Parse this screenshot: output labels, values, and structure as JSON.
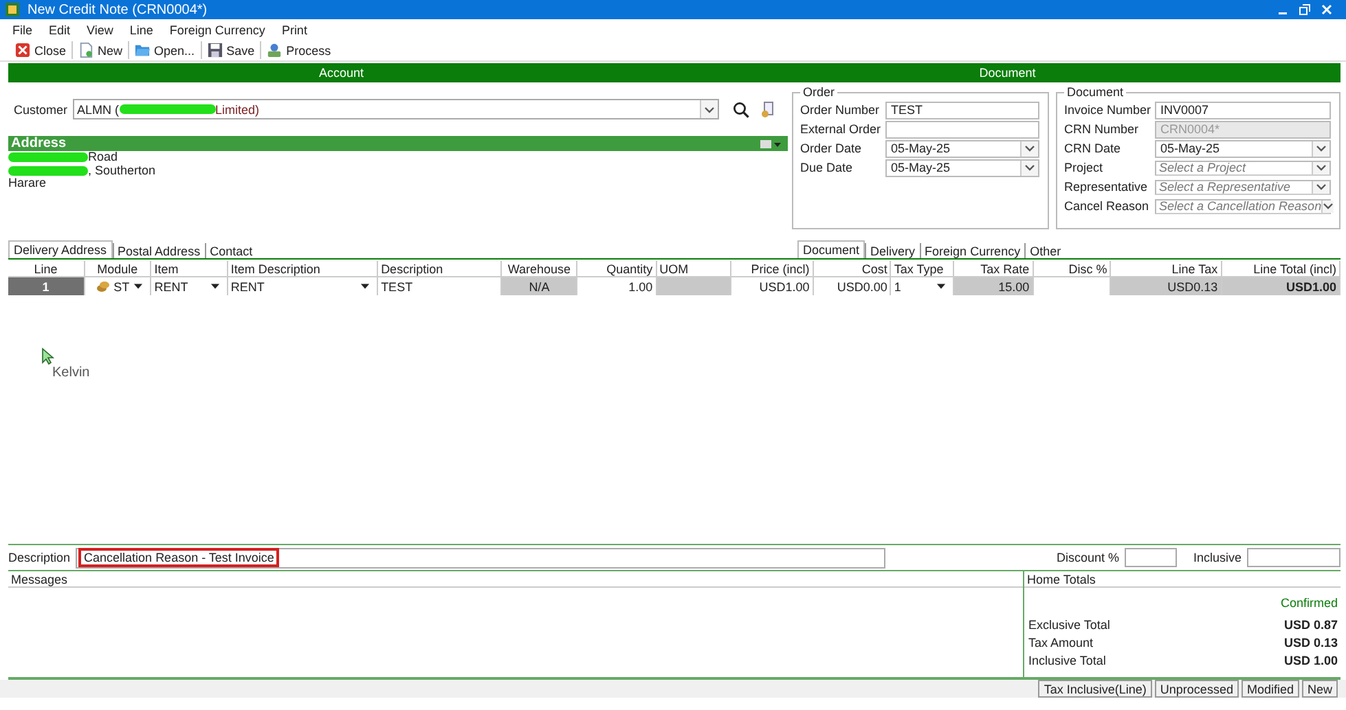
{
  "window": {
    "title": "New Credit Note (CRN0004*)"
  },
  "menu": [
    "File",
    "Edit",
    "View",
    "Line",
    "Foreign Currency",
    "Print"
  ],
  "toolbar": [
    {
      "kind": "close",
      "label": "Close"
    },
    {
      "kind": "new",
      "label": "New"
    },
    {
      "kind": "open",
      "label": "Open..."
    },
    {
      "kind": "save",
      "label": "Save"
    },
    {
      "kind": "process",
      "label": "Process"
    }
  ],
  "section_bar": [
    "Account",
    "Document"
  ],
  "customer": {
    "label": "Customer",
    "value_start": "ALMN (",
    "value_end": "Limited)"
  },
  "address": {
    "title": "Address",
    "lines": [
      {
        "redacted": true,
        "text": "Road"
      },
      {
        "redacted": true,
        "text": ", Southerton"
      },
      {
        "redacted": false,
        "text": "Harare"
      }
    ]
  },
  "left_tabs": [
    {
      "label": "Delivery Address",
      "selected": true
    },
    {
      "label": "Postal Address",
      "selected": false
    },
    {
      "label": "Contact",
      "selected": false
    }
  ],
  "order": {
    "title": "Order",
    "fields": [
      {
        "label": "Order Number",
        "kind": "text",
        "value": "TEST"
      },
      {
        "label": "External Order",
        "kind": "text"
      },
      {
        "label": "Order Date",
        "kind": "dropdown",
        "value": "05-May-25"
      },
      {
        "label": "Due Date",
        "kind": "dropdown",
        "value": "05-May-25"
      }
    ]
  },
  "document": {
    "title": "Document",
    "fields": [
      {
        "label": "Invoice Number",
        "kind": "text",
        "value": "INV0007"
      },
      {
        "label": "CRN Number",
        "kind": "text",
        "value": "CRN0004*",
        "disabled": true
      },
      {
        "label": "CRN Date",
        "kind": "dropdown",
        "value": "05-May-25"
      },
      {
        "label": "Project",
        "kind": "dropdown",
        "placeholder": "Select a Project"
      },
      {
        "label": "Representative",
        "kind": "dropdown",
        "placeholder": "Select a Representative"
      },
      {
        "label": "Cancel Reason",
        "kind": "dropdown",
        "placeholder": "Select a Cancellation Reason"
      }
    ]
  },
  "right_tabs": [
    {
      "label": "Document",
      "selected": true
    },
    {
      "label": "Delivery",
      "selected": false
    },
    {
      "label": "Foreign Currency",
      "selected": false
    },
    {
      "label": "Other",
      "selected": false
    }
  ],
  "table": {
    "columns": [
      "Line",
      "Module",
      "Item",
      "Item Description",
      "Description",
      "Warehouse",
      "Quantity",
      "UOM",
      "Price (incl)",
      "Cost",
      "Tax Type",
      "Tax Rate",
      "Disc %",
      "Line Tax",
      "Line Total (incl)"
    ],
    "rows": [
      {
        "cells": [
          {
            "kind": "line",
            "text": "1"
          },
          {
            "kind": "module",
            "text": "ST"
          },
          {
            "kind": "dropdown",
            "text": "RENT"
          },
          {
            "kind": "dropdown",
            "text": "RENT"
          },
          {
            "kind": "text",
            "text": "TEST"
          },
          {
            "kind": "readonly",
            "text": "N/A"
          },
          {
            "kind": "text",
            "text": "1.00"
          },
          {
            "kind": "readonly"
          },
          {
            "kind": "text",
            "text": "USD1.00"
          },
          {
            "kind": "text",
            "text": "USD0.00"
          },
          {
            "kind": "dropdown",
            "text": "1"
          },
          {
            "kind": "readonly",
            "text": "15.00"
          },
          {
            "kind": "text"
          },
          {
            "kind": "readonly",
            "text": "USD0.13"
          },
          {
            "kind": "total",
            "text": "USD1.00"
          }
        ]
      }
    ]
  },
  "cursor": {
    "label": "Kelvin"
  },
  "description": {
    "label": "Description",
    "value": "Cancellation Reason - Test Invoice",
    "highlighted": true
  },
  "discount": {
    "label": "Discount %"
  },
  "inclusive": {
    "label": "Inclusive"
  },
  "messages": {
    "title": "Messages"
  },
  "home_totals": {
    "title": "Home Totals",
    "status": "Confirmed",
    "rows": [
      {
        "label": "Exclusive Total",
        "value": "USD 0.87"
      },
      {
        "label": "Tax Amount",
        "value": "USD 0.13"
      },
      {
        "label": "Inclusive Total",
        "value": "USD 1.00"
      }
    ]
  },
  "status_bar": [
    "Tax Inclusive(Line)",
    "Unprocessed",
    "Modified",
    "New"
  ]
}
